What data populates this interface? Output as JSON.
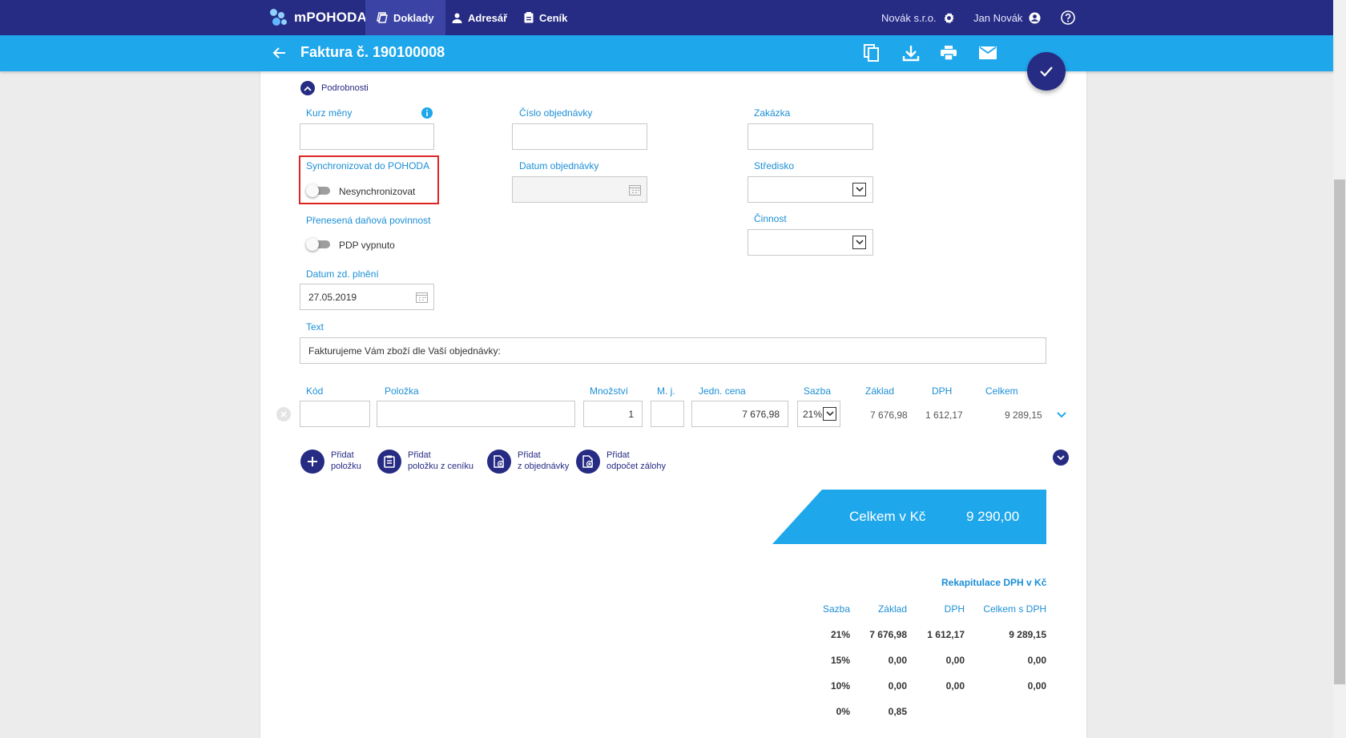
{
  "nav": {
    "brand": "mPOHODA",
    "tabs": [
      {
        "label": "Doklady"
      },
      {
        "label": "Adresář"
      },
      {
        "label": "Ceník"
      }
    ],
    "company": "Novák s.r.o.",
    "user": "Jan Novák"
  },
  "header": {
    "title": "Faktura č. 190100008",
    "icons": [
      "copy-icon",
      "download-icon",
      "print-icon",
      "mail-icon"
    ]
  },
  "details": {
    "section_label": "Podrobnosti",
    "kurz_label": "Kurz měny",
    "kurz_value": "",
    "cislo_obj_label": "Číslo objednávky",
    "cislo_obj_value": "",
    "zakazka_label": "Zakázka",
    "zakazka_value": "",
    "sync_label": "Synchronizovat do POHODA",
    "sync_toggle_text": "Nesynchronizovat",
    "datum_obj_label": "Datum objednávky",
    "datum_obj_value": "",
    "stredisko_label": "Středisko",
    "stredisko_value": "",
    "pdp_label": "Přenesená daňová povinnost",
    "pdp_toggle_text": "PDP vypnuto",
    "cinnost_label": "Činnost",
    "cinnost_value": "",
    "datum_zd_label": "Datum zd. plnění",
    "datum_zd_value": "27.05.2019",
    "text_label": "Text",
    "text_value": "Fakturujeme Vám zboží dle Vaší objednávky:"
  },
  "items": {
    "headers": {
      "kod": "Kód",
      "polozka": "Položka",
      "mnozstvi": "Množství",
      "mj": "M. j.",
      "jedn_cena": "Jedn. cena",
      "sazba": "Sazba",
      "zaklad": "Základ",
      "dph": "DPH",
      "celkem": "Celkem"
    },
    "rows": [
      {
        "kod": "",
        "polozka": "",
        "mnozstvi": "1",
        "mj": "",
        "jedn_cena": "7 676,98",
        "sazba": "21%",
        "zaklad": "7 676,98",
        "dph": "1 612,17",
        "celkem": "9 289,15"
      }
    ]
  },
  "actions": [
    {
      "line1": "Přidat",
      "line2": "položku"
    },
    {
      "line1": "Přidat",
      "line2": "položku z ceníku"
    },
    {
      "line1": "Přidat",
      "line2": "z objednávky"
    },
    {
      "line1": "Přidat",
      "line2": "odpočet zálohy"
    }
  ],
  "total": {
    "label": "Celkem v Kč",
    "value": "9 290,00"
  },
  "recap": {
    "title": "Rekapitulace DPH v Kč",
    "headers": {
      "sazba": "Sazba",
      "zaklad": "Základ",
      "dph": "DPH",
      "celkem": "Celkem s DPH"
    },
    "rows": [
      {
        "sazba": "21%",
        "zaklad": "7 676,98",
        "dph": "1 612,17",
        "celkem": "9 289,15"
      },
      {
        "sazba": "15%",
        "zaklad": "0,00",
        "dph": "0,00",
        "celkem": "0,00"
      },
      {
        "sazba": "10%",
        "zaklad": "0,00",
        "dph": "0,00",
        "celkem": "0,00"
      },
      {
        "sazba": "0%",
        "zaklad": "0,85",
        "dph": "",
        "celkem": ""
      }
    ]
  },
  "colors": {
    "nav_bg": "#262b83",
    "header_bg": "#1fa7ec",
    "label": "#1c8fd6",
    "highlight": "#e02424"
  }
}
